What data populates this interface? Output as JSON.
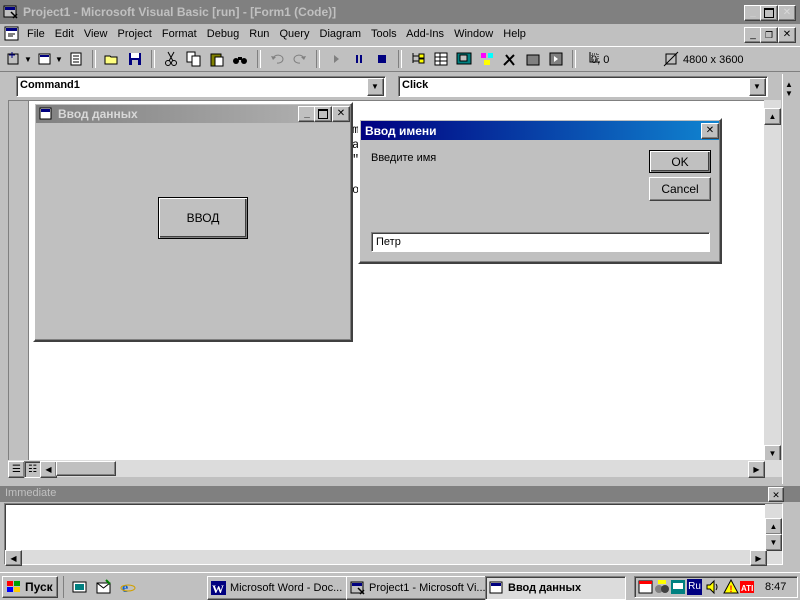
{
  "window": {
    "title": "Project1 - Microsoft Visual Basic [run] - [Form1 (Code)]"
  },
  "menu": [
    "File",
    "Edit",
    "View",
    "Project",
    "Format",
    "Debug",
    "Run",
    "Query",
    "Diagram",
    "Tools",
    "Add-Ins",
    "Window",
    "Help"
  ],
  "toolbar": {
    "coords": "0, 0",
    "size": "4800 x 3600"
  },
  "code": {
    "object": "Command1",
    "procedure": "Click"
  },
  "form": {
    "title": "Ввод данных",
    "button": "ВВОД"
  },
  "inputbox": {
    "title": "Ввод имени",
    "prompt": "Введите имя",
    "ok": "OK",
    "cancel": "Cancel",
    "value": "Петр"
  },
  "immediate": {
    "title": "Immediate"
  },
  "taskbar": {
    "start": "Пуск",
    "tasks": [
      "Microsoft Word - Doc...",
      "Project1 - Microsoft Vi...",
      "Ввод данных"
    ],
    "lang": "Ru",
    "time": "8:47"
  },
  "colors": {
    "active_title": "#000080",
    "face": "#c0c0c0"
  }
}
